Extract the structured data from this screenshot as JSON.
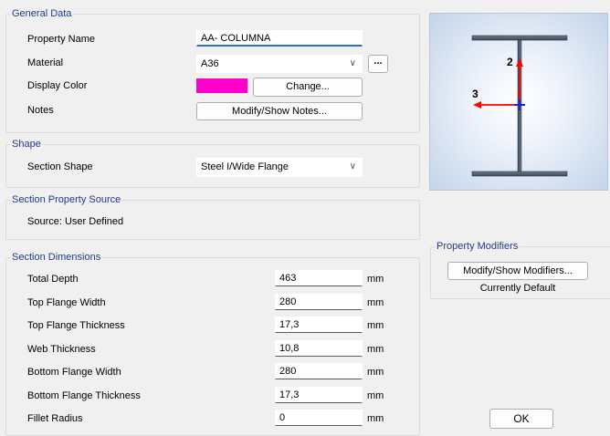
{
  "general": {
    "legend": "General Data",
    "property_name_label": "Property Name",
    "property_name_value": "AA- COLUMNA",
    "material_label": "Material",
    "material_value": "A36",
    "material_more": "...",
    "display_color_label": "Display Color",
    "display_color": "#ff00cc",
    "change_button": "Change...",
    "notes_label": "Notes",
    "notes_button": "Modify/Show Notes..."
  },
  "shape": {
    "legend": "Shape",
    "section_shape_label": "Section Shape",
    "section_shape_value": "Steel I/Wide Flange"
  },
  "source": {
    "legend": "Section Property Source",
    "text": "Source:  User Defined"
  },
  "dimensions": {
    "legend": "Section Dimensions",
    "rows": [
      {
        "label": "Total Depth",
        "value": "463",
        "unit": "mm"
      },
      {
        "label": "Top Flange Width",
        "value": "280",
        "unit": "mm"
      },
      {
        "label": "Top Flange Thickness",
        "value": "17,3",
        "unit": "mm"
      },
      {
        "label": "Web Thickness",
        "value": "10,8",
        "unit": "mm"
      },
      {
        "label": "Bottom Flange Width",
        "value": "280",
        "unit": "mm"
      },
      {
        "label": "Bottom Flange Thickness",
        "value": "17,3",
        "unit": "mm"
      },
      {
        "label": "Fillet Radius",
        "value": "0",
        "unit": "mm"
      }
    ]
  },
  "preview": {
    "axis_2": "2",
    "axis_3": "3"
  },
  "modifiers": {
    "legend": "Property Modifiers",
    "button": "Modify/Show Modifiers...",
    "status": "Currently Default"
  },
  "ok_button": "OK"
}
